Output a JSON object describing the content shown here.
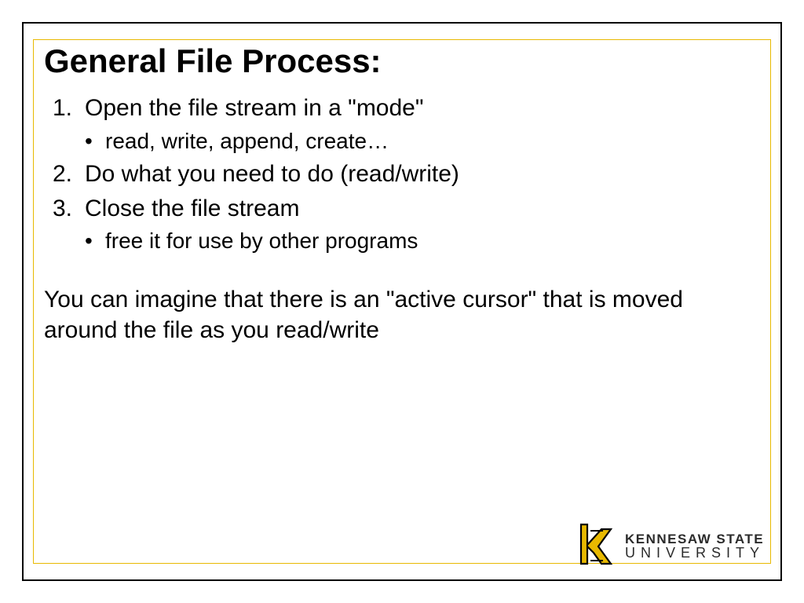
{
  "title": "General File Process:",
  "list": {
    "item1_num": "1.",
    "item1_text": "Open the file stream in a \"mode\"",
    "item1_sub": "read, write, append, create…",
    "item2_num": "2.",
    "item2_text": "Do what you need to do (read/write)",
    "item3_num": "3.",
    "item3_text": "Close the file stream",
    "item3_sub": "free it for use by other programs"
  },
  "paragraph": "You can imagine that there is an \"active cursor\" that is moved around the file as you read/write",
  "logo": {
    "line1": "KENNESAW STATE",
    "line2": "UNIVERSITY"
  }
}
